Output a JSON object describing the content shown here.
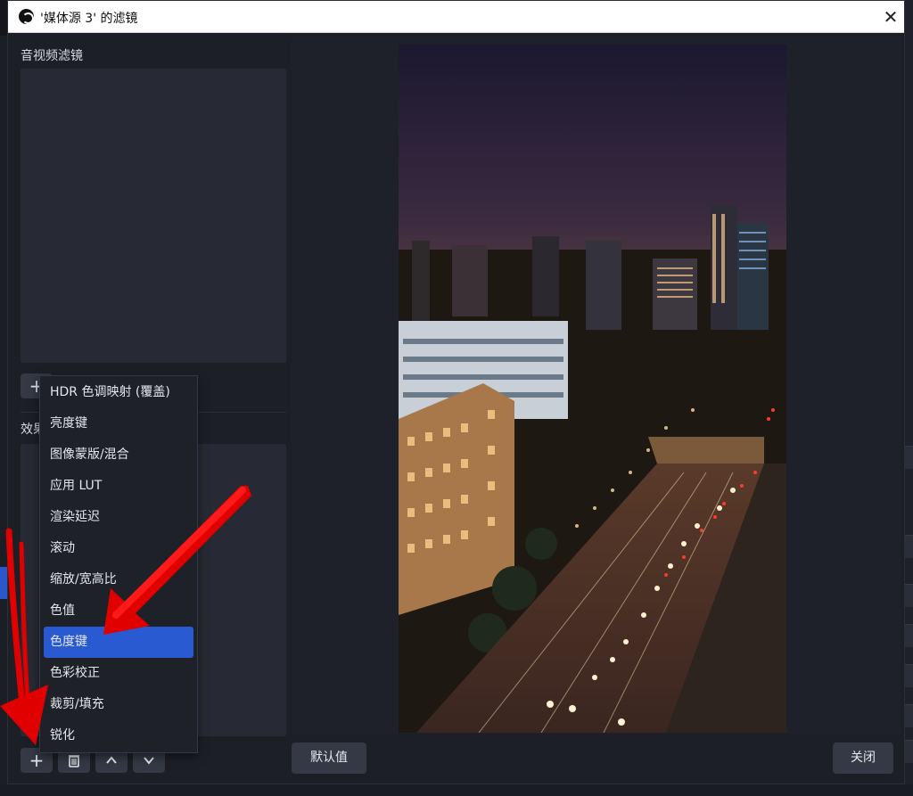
{
  "dialog": {
    "title": "'媒体源 3' 的滤镜",
    "close_symbol": "✕"
  },
  "sections": {
    "av_filters_label": "音视频滤镜",
    "effect_filters_label": "效果滤镜"
  },
  "menu": {
    "items": [
      {
        "label": "HDR 色调映射 (覆盖)",
        "selected": false
      },
      {
        "label": "亮度键",
        "selected": false
      },
      {
        "label": "图像蒙版/混合",
        "selected": false
      },
      {
        "label": "应用 LUT",
        "selected": false
      },
      {
        "label": "渲染延迟",
        "selected": false
      },
      {
        "label": "滚动",
        "selected": false
      },
      {
        "label": "缩放/宽高比",
        "selected": false
      },
      {
        "label": "色值",
        "selected": false
      },
      {
        "label": "色度键",
        "selected": true
      },
      {
        "label": "色彩校正",
        "selected": false
      },
      {
        "label": "裁剪/填充",
        "selected": false
      },
      {
        "label": "锐化",
        "selected": false
      }
    ],
    "highlight_color": "#2a5ad1"
  },
  "toolbar": {
    "add_symbol": "+",
    "icons": [
      "plus-icon",
      "trash-icon",
      "chevron-up-icon",
      "chevron-down-icon"
    ]
  },
  "buttons": {
    "defaults_label": "默认值",
    "close_label": "关闭"
  },
  "annotations": {
    "arrow_color": "#e00000"
  }
}
